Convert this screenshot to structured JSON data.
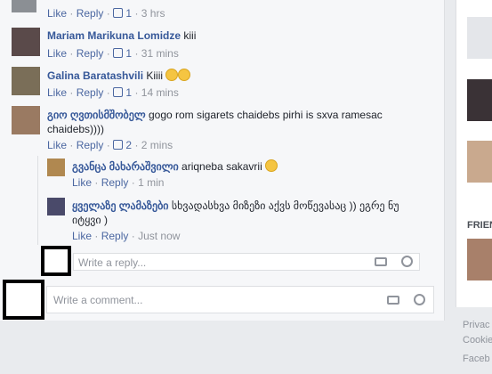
{
  "comments": [
    {
      "author": "",
      "text": "",
      "like": "Like",
      "reply": "Reply",
      "likes": "1",
      "time": "3 hrs"
    },
    {
      "author": "Mariam Marikuna Lomidze",
      "text": "kiii",
      "like": "Like",
      "reply": "Reply",
      "likes": "1",
      "time": "31 mins"
    },
    {
      "author": "Galina Baratashvili",
      "text": "Kiiii",
      "like": "Like",
      "reply": "Reply",
      "likes": "1",
      "time": "14 mins"
    },
    {
      "author": "გიო ღვთისმშობელ",
      "text": "gogo rom sigarets chaidebs pirhi is sxva ramesac chaidebs))))",
      "like": "Like",
      "reply": "Reply",
      "likes": "2",
      "time": "2 mins"
    }
  ],
  "replies": [
    {
      "author": "გვანცა მახარაშვილი",
      "text": "ariqneba sakavrii",
      "like": "Like",
      "reply": "Reply",
      "time": "1 min"
    },
    {
      "author": "ყველაზე ლამაზები",
      "text": "სხვადასხვა მიზეზი აქვს მოწევასაც )) ეგრე ნუ იტყვი )",
      "like": "Like",
      "reply": "Reply",
      "time": "Just now"
    }
  ],
  "reply_input": {
    "placeholder": "Write a reply..."
  },
  "comment_input": {
    "placeholder": "Write a comment..."
  },
  "sidebar": {
    "friends_label": "FRIEN"
  },
  "footer": {
    "links": [
      "Privac",
      "Cookie",
      "Faceb"
    ]
  },
  "sep": "·"
}
